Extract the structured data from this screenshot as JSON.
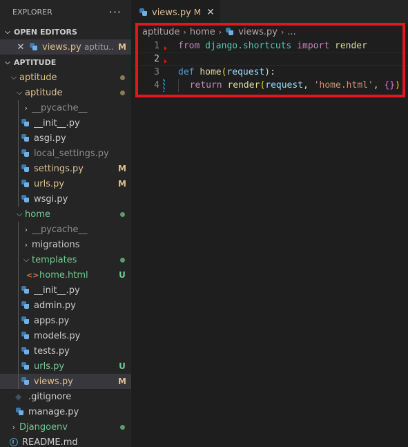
{
  "explorer": {
    "title": "EXPLORER",
    "more_label": "···"
  },
  "open_editors": {
    "header": "OPEN EDITORS",
    "items": [
      {
        "name": "views.py",
        "description": "aptitu...",
        "badge": "M"
      }
    ]
  },
  "workspace": {
    "header": "APTITUDE",
    "tree": [
      {
        "name": "aptitude",
        "badge": ""
      },
      {
        "name": "aptitude",
        "badge": ""
      },
      {
        "name": "__pycache__",
        "badge": ""
      },
      {
        "name": "__init__.py",
        "badge": ""
      },
      {
        "name": "asgi.py",
        "badge": ""
      },
      {
        "name": "local_settings.py",
        "badge": ""
      },
      {
        "name": "settings.py",
        "badge": "M"
      },
      {
        "name": "urls.py",
        "badge": "M"
      },
      {
        "name": "wsgi.py",
        "badge": ""
      },
      {
        "name": "home",
        "badge": ""
      },
      {
        "name": "__pycache__",
        "badge": ""
      },
      {
        "name": "migrations",
        "badge": ""
      },
      {
        "name": "templates",
        "badge": ""
      },
      {
        "name": "home.html",
        "badge": "U"
      },
      {
        "name": "__init__.py",
        "badge": ""
      },
      {
        "name": "admin.py",
        "badge": ""
      },
      {
        "name": "apps.py",
        "badge": ""
      },
      {
        "name": "models.py",
        "badge": ""
      },
      {
        "name": "tests.py",
        "badge": ""
      },
      {
        "name": "urls.py",
        "badge": "U"
      },
      {
        "name": "views.py",
        "badge": "M"
      },
      {
        "name": ".gitignore",
        "badge": ""
      },
      {
        "name": "manage.py",
        "badge": ""
      },
      {
        "name": "Djangoenv",
        "badge": ""
      },
      {
        "name": "README.md",
        "badge": ""
      }
    ]
  },
  "editor": {
    "tab": {
      "label": "views.py",
      "badge": "M",
      "close": "✕"
    },
    "breadcrumb": [
      "aptitude",
      "home",
      "views.py",
      "..."
    ],
    "lines": [
      {
        "num": "1",
        "tokens": [
          "from",
          " ",
          "django.shortcuts",
          " ",
          "import",
          " ",
          "render"
        ]
      },
      {
        "num": "2",
        "tokens": []
      },
      {
        "num": "3",
        "tokens": [
          "def",
          " ",
          "home",
          "(",
          "request",
          "):"
        ]
      },
      {
        "num": "4",
        "tokens": [
          "return",
          " ",
          "render",
          "(",
          "request",
          ", ",
          "'home.html'",
          ", ",
          "{}",
          ")"
        ]
      }
    ]
  },
  "colors": {
    "modified": "#e2c08d",
    "untracked": "#73c991",
    "highlight_box": "#e3161e"
  },
  "icons": {
    "python": "python-file-icon",
    "html": "html-file-icon",
    "git": "gitignore-icon",
    "readme": "info-icon",
    "close": "close-icon",
    "chevron": "chevron-icon"
  }
}
